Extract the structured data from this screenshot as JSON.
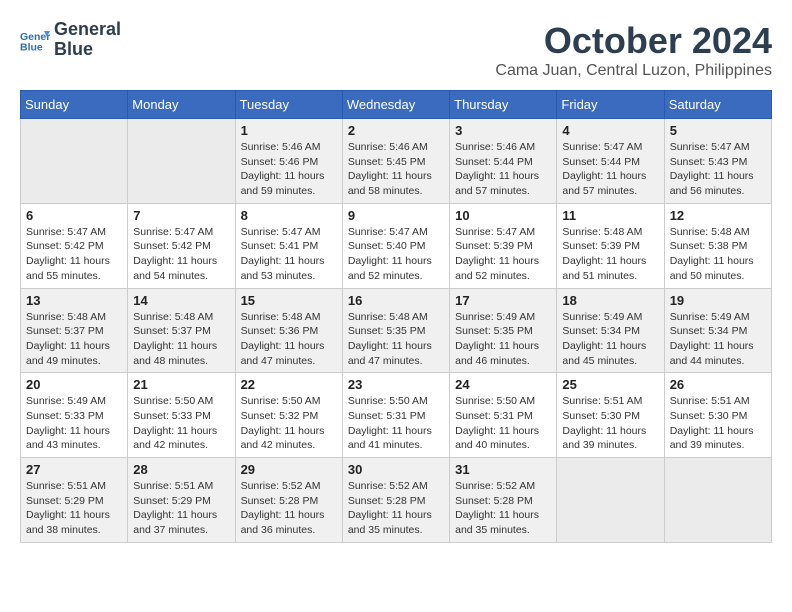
{
  "header": {
    "logo_line1": "General",
    "logo_line2": "Blue",
    "month": "October 2024",
    "location": "Cama Juan, Central Luzon, Philippines"
  },
  "weekdays": [
    "Sunday",
    "Monday",
    "Tuesday",
    "Wednesday",
    "Thursday",
    "Friday",
    "Saturday"
  ],
  "weeks": [
    [
      {
        "day": "",
        "sunrise": "",
        "sunset": "",
        "daylight": ""
      },
      {
        "day": "",
        "sunrise": "",
        "sunset": "",
        "daylight": ""
      },
      {
        "day": "1",
        "sunrise": "Sunrise: 5:46 AM",
        "sunset": "Sunset: 5:46 PM",
        "daylight": "Daylight: 11 hours and 59 minutes."
      },
      {
        "day": "2",
        "sunrise": "Sunrise: 5:46 AM",
        "sunset": "Sunset: 5:45 PM",
        "daylight": "Daylight: 11 hours and 58 minutes."
      },
      {
        "day": "3",
        "sunrise": "Sunrise: 5:46 AM",
        "sunset": "Sunset: 5:44 PM",
        "daylight": "Daylight: 11 hours and 57 minutes."
      },
      {
        "day": "4",
        "sunrise": "Sunrise: 5:47 AM",
        "sunset": "Sunset: 5:44 PM",
        "daylight": "Daylight: 11 hours and 57 minutes."
      },
      {
        "day": "5",
        "sunrise": "Sunrise: 5:47 AM",
        "sunset": "Sunset: 5:43 PM",
        "daylight": "Daylight: 11 hours and 56 minutes."
      }
    ],
    [
      {
        "day": "6",
        "sunrise": "Sunrise: 5:47 AM",
        "sunset": "Sunset: 5:42 PM",
        "daylight": "Daylight: 11 hours and 55 minutes."
      },
      {
        "day": "7",
        "sunrise": "Sunrise: 5:47 AM",
        "sunset": "Sunset: 5:42 PM",
        "daylight": "Daylight: 11 hours and 54 minutes."
      },
      {
        "day": "8",
        "sunrise": "Sunrise: 5:47 AM",
        "sunset": "Sunset: 5:41 PM",
        "daylight": "Daylight: 11 hours and 53 minutes."
      },
      {
        "day": "9",
        "sunrise": "Sunrise: 5:47 AM",
        "sunset": "Sunset: 5:40 PM",
        "daylight": "Daylight: 11 hours and 52 minutes."
      },
      {
        "day": "10",
        "sunrise": "Sunrise: 5:47 AM",
        "sunset": "Sunset: 5:39 PM",
        "daylight": "Daylight: 11 hours and 52 minutes."
      },
      {
        "day": "11",
        "sunrise": "Sunrise: 5:48 AM",
        "sunset": "Sunset: 5:39 PM",
        "daylight": "Daylight: 11 hours and 51 minutes."
      },
      {
        "day": "12",
        "sunrise": "Sunrise: 5:48 AM",
        "sunset": "Sunset: 5:38 PM",
        "daylight": "Daylight: 11 hours and 50 minutes."
      }
    ],
    [
      {
        "day": "13",
        "sunrise": "Sunrise: 5:48 AM",
        "sunset": "Sunset: 5:37 PM",
        "daylight": "Daylight: 11 hours and 49 minutes."
      },
      {
        "day": "14",
        "sunrise": "Sunrise: 5:48 AM",
        "sunset": "Sunset: 5:37 PM",
        "daylight": "Daylight: 11 hours and 48 minutes."
      },
      {
        "day": "15",
        "sunrise": "Sunrise: 5:48 AM",
        "sunset": "Sunset: 5:36 PM",
        "daylight": "Daylight: 11 hours and 47 minutes."
      },
      {
        "day": "16",
        "sunrise": "Sunrise: 5:48 AM",
        "sunset": "Sunset: 5:35 PM",
        "daylight": "Daylight: 11 hours and 47 minutes."
      },
      {
        "day": "17",
        "sunrise": "Sunrise: 5:49 AM",
        "sunset": "Sunset: 5:35 PM",
        "daylight": "Daylight: 11 hours and 46 minutes."
      },
      {
        "day": "18",
        "sunrise": "Sunrise: 5:49 AM",
        "sunset": "Sunset: 5:34 PM",
        "daylight": "Daylight: 11 hours and 45 minutes."
      },
      {
        "day": "19",
        "sunrise": "Sunrise: 5:49 AM",
        "sunset": "Sunset: 5:34 PM",
        "daylight": "Daylight: 11 hours and 44 minutes."
      }
    ],
    [
      {
        "day": "20",
        "sunrise": "Sunrise: 5:49 AM",
        "sunset": "Sunset: 5:33 PM",
        "daylight": "Daylight: 11 hours and 43 minutes."
      },
      {
        "day": "21",
        "sunrise": "Sunrise: 5:50 AM",
        "sunset": "Sunset: 5:33 PM",
        "daylight": "Daylight: 11 hours and 42 minutes."
      },
      {
        "day": "22",
        "sunrise": "Sunrise: 5:50 AM",
        "sunset": "Sunset: 5:32 PM",
        "daylight": "Daylight: 11 hours and 42 minutes."
      },
      {
        "day": "23",
        "sunrise": "Sunrise: 5:50 AM",
        "sunset": "Sunset: 5:31 PM",
        "daylight": "Daylight: 11 hours and 41 minutes."
      },
      {
        "day": "24",
        "sunrise": "Sunrise: 5:50 AM",
        "sunset": "Sunset: 5:31 PM",
        "daylight": "Daylight: 11 hours and 40 minutes."
      },
      {
        "day": "25",
        "sunrise": "Sunrise: 5:51 AM",
        "sunset": "Sunset: 5:30 PM",
        "daylight": "Daylight: 11 hours and 39 minutes."
      },
      {
        "day": "26",
        "sunrise": "Sunrise: 5:51 AM",
        "sunset": "Sunset: 5:30 PM",
        "daylight": "Daylight: 11 hours and 39 minutes."
      }
    ],
    [
      {
        "day": "27",
        "sunrise": "Sunrise: 5:51 AM",
        "sunset": "Sunset: 5:29 PM",
        "daylight": "Daylight: 11 hours and 38 minutes."
      },
      {
        "day": "28",
        "sunrise": "Sunrise: 5:51 AM",
        "sunset": "Sunset: 5:29 PM",
        "daylight": "Daylight: 11 hours and 37 minutes."
      },
      {
        "day": "29",
        "sunrise": "Sunrise: 5:52 AM",
        "sunset": "Sunset: 5:28 PM",
        "daylight": "Daylight: 11 hours and 36 minutes."
      },
      {
        "day": "30",
        "sunrise": "Sunrise: 5:52 AM",
        "sunset": "Sunset: 5:28 PM",
        "daylight": "Daylight: 11 hours and 35 minutes."
      },
      {
        "day": "31",
        "sunrise": "Sunrise: 5:52 AM",
        "sunset": "Sunset: 5:28 PM",
        "daylight": "Daylight: 11 hours and 35 minutes."
      },
      {
        "day": "",
        "sunrise": "",
        "sunset": "",
        "daylight": ""
      },
      {
        "day": "",
        "sunrise": "",
        "sunset": "",
        "daylight": ""
      }
    ]
  ]
}
